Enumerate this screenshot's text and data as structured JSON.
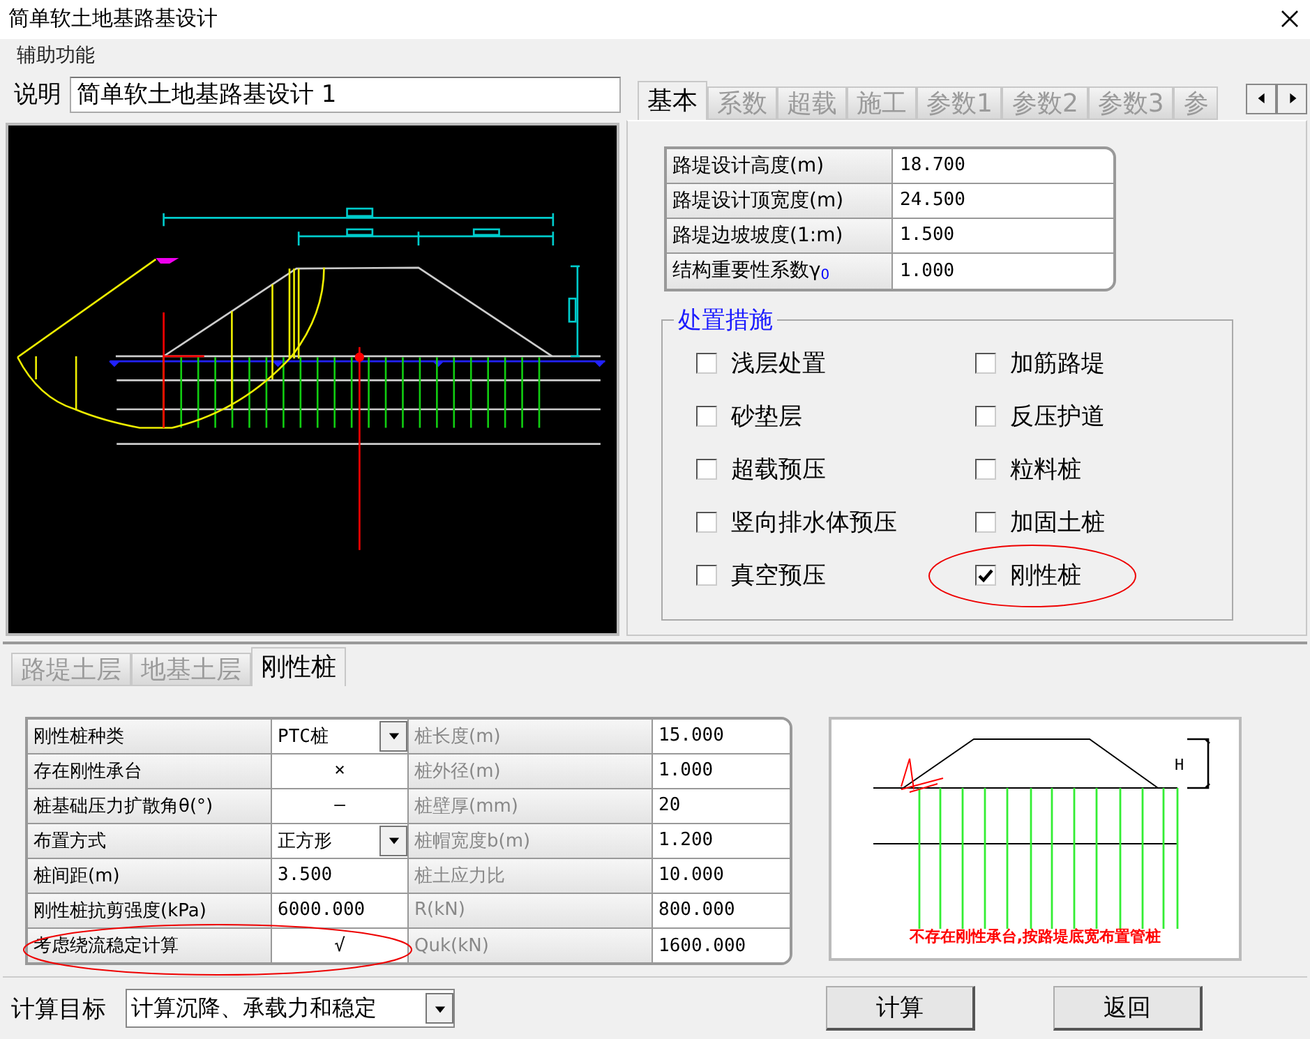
{
  "window": {
    "title": "简单软土地基路基设计"
  },
  "menu": [
    "辅助功能"
  ],
  "description": {
    "label": "说明",
    "value": "简单软土地基路基设计 1"
  },
  "top_tabs": [
    {
      "label": "基本",
      "selected": true
    },
    {
      "label": "系数",
      "selected": false
    },
    {
      "label": "超载",
      "selected": false
    },
    {
      "label": "施工",
      "selected": false
    },
    {
      "label": "参数1",
      "selected": false
    },
    {
      "label": "参数2",
      "selected": false
    },
    {
      "label": "参数3",
      "selected": false
    },
    {
      "label": "参",
      "selected": false
    }
  ],
  "basic_params": [
    {
      "label": "路堤设计高度(m)",
      "value": "18.700"
    },
    {
      "label": "路堤设计顶宽度(m)",
      "value": "24.500"
    },
    {
      "label": "路堤边坡坡度(1:m)",
      "value": "1.500"
    },
    {
      "label": "结构重要性系数γ$_{0}$",
      "value": "1.000"
    }
  ],
  "measures": {
    "title": "处置措施",
    "items": [
      {
        "label": "浅层处置",
        "checked": false
      },
      {
        "label": "加筋路堤",
        "checked": false
      },
      {
        "label": "砂垫层",
        "checked": false
      },
      {
        "label": "反压护道",
        "checked": false
      },
      {
        "label": "超载预压",
        "checked": false
      },
      {
        "label": "粒料桩",
        "checked": false
      },
      {
        "label": "竖向排水体预压",
        "checked": false
      },
      {
        "label": "加固土桩",
        "checked": false
      },
      {
        "label": "真空预压",
        "checked": false
      },
      {
        "label": "刚性桩",
        "checked": true
      }
    ]
  },
  "bottom_tabs": [
    {
      "label": "路堤土层",
      "selected": false
    },
    {
      "label": "地基土层",
      "selected": false
    },
    {
      "label": "刚性桩",
      "selected": true
    }
  ],
  "pile_table": [
    {
      "label": "刚性桩种类",
      "value": "PTC桩",
      "kind": "dropdown",
      "label_2": "桩长度(m)",
      "value_2": "15.000"
    },
    {
      "label": "存在刚性承台",
      "value": "×",
      "kind": "mark",
      "label_2": "桩外径(m)",
      "value_2": "1.000"
    },
    {
      "label": "桩基础压力扩散角θ(°)",
      "value": "—",
      "kind": "mark",
      "label_2": "桩壁厚(mm)",
      "value_2": "20"
    },
    {
      "label": "布置方式",
      "value": "正方形",
      "kind": "dropdown",
      "label_2": "桩帽宽度b(m)",
      "value_2": "1.200"
    },
    {
      "label": "桩间距(m)",
      "value": "3.500",
      "kind": "text",
      "label_2": "桩土应力比",
      "value_2": "10.000"
    },
    {
      "label": "刚性桩抗剪强度(kPa)",
      "value": "6000.000",
      "kind": "text",
      "label_2": "R(kN)",
      "value_2": "800.000"
    },
    {
      "label": "考虑绕流稳定计算",
      "value": "√",
      "kind": "mark",
      "label_2": "Quk(kN)",
      "value_2": "1600.000"
    }
  ],
  "schematic": {
    "height_label": "H",
    "note": "不存在刚性承台,按路堤底宽布置管桩"
  },
  "target": {
    "label": "计算目标",
    "value": "计算沉降、承载力和稳定"
  },
  "buttons": [
    "计算",
    "返回"
  ]
}
